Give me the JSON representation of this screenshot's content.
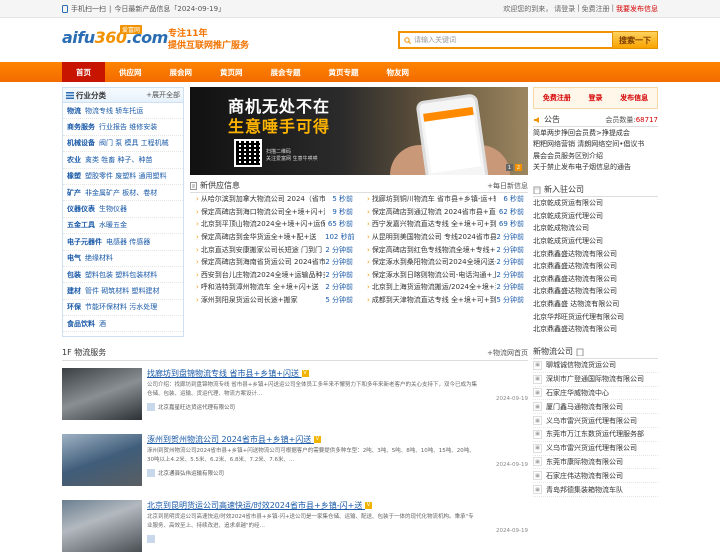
{
  "topbar": {
    "mobile": "手机扫一扫",
    "sep": "|",
    "today": "今日最新产品信息「2024-09-19」",
    "welcome": "欢迎您的到来，",
    "login": "请登录",
    "register": "免费注册",
    "publish": "我要发布信息",
    "pipe1": "|",
    "pipe2": "|"
  },
  "header": {
    "logo_a": "aifu",
    "logo_b": "360",
    "logo_c": ".com",
    "logo_badge": "爱富网",
    "slogan1": "专注11年",
    "slogan2": "提供互联网推广服务",
    "search_placeholder": "请输入关键词",
    "search_button": "搜索一下"
  },
  "nav": [
    "首页",
    "供应网",
    "展会网",
    "黄页网",
    "展会专题",
    "黄页专题",
    "物友网"
  ],
  "categories": {
    "title": "行业分类",
    "more": "+展开全部",
    "rows": [
      {
        "c": "物流",
        "s": "物流专线  轿车托运"
      },
      {
        "c": "商务服务",
        "s": "行业报告  维修安装"
      },
      {
        "c": "机械设备",
        "s": "阀门  泵  模具  工程机械"
      },
      {
        "c": "农业",
        "s": "禽类  牲畜  种子、种苗"
      },
      {
        "c": "橡塑",
        "s": "塑胶零件  废塑料  通用塑料"
      },
      {
        "c": "矿产",
        "s": "非金属矿产  板材、卷材"
      },
      {
        "c": "仪器仪表",
        "s": "生物仪器"
      },
      {
        "c": "五金工具",
        "s": "水暖五金"
      },
      {
        "c": "电子元器件",
        "s": "电感器  传感器"
      },
      {
        "c": "电气",
        "s": "绝缘材料"
      },
      {
        "c": "包装",
        "s": "塑料包装  塑料包装材料"
      },
      {
        "c": "建材",
        "s": "管件  砌筑材料  塑料建材"
      },
      {
        "c": "环保",
        "s": "节能环保材料  污水处理"
      },
      {
        "c": "食品饮料",
        "s": "酒"
      }
    ]
  },
  "banner": {
    "line1": "商机无处不在",
    "line2": "生意唾手可得",
    "qr_text1": "扫描二维码",
    "qr_text2": "关注爱富网  生意牛哄哄",
    "dot1": "1",
    "dot2": "2"
  },
  "right_top": [
    "免费注册",
    "登录",
    "发布信息"
  ],
  "notice": {
    "title": "公告",
    "count_label": "会员数量:",
    "count": "68717",
    "items": [
      "简单两步挣回会员费>挣提成会",
      "粑粑网络营销 清朗网络空间•倡议书",
      "展会会员服务区别介绍",
      "关于禁止发布电子烟信息的通告"
    ]
  },
  "info": {
    "title": "新供应信息",
    "more": "+每日新信息",
    "rows": [
      [
        "从哈尔滨到加拿大物流公司 2024（省市",
        "5 秒前",
        "找廊坊到铜川物流车 省市县+乡镇-运+输",
        "6 秒前"
      ],
      [
        "保定高碑店到海口物流公司全+境+闪+送",
        "9 秒前",
        "保定高碑店到通辽物流 2024省市县+直达",
        "62 秒前"
      ],
      [
        "北京到平顶山物流2024全+境+闪+运保时",
        "65 秒前",
        "西宁发嘉兴物流直达专线  全+境+可+到",
        "69 秒前"
      ],
      [
        "保定高碑店到金华货运全+境+配+送",
        "102 秒前",
        "从昆明到美国物流公司 专线2024省市县+",
        "2 分钟前"
      ],
      [
        "北京直达到安康搬家公司长短途 门到门",
        "2 分钟前",
        "保定高碑店到红色专线物流全境+专线+",
        "2 分钟前"
      ],
      [
        "保定高碑店到海南省货运公司 2024省市县+",
        "2 分钟前",
        "保定涿水到桑阳物流公司2024全境闪送+",
        "2 分钟前"
      ],
      [
        "西安到台儿庄物流2024全境+运输品种多",
        "2 分钟前",
        "保定涿水到日喀则物流公司-电话沟通+上",
        "2 分钟前"
      ],
      [
        "呼和浩特到漳州物流车  全+境+闪+送",
        "2 分钟前",
        "北京到上海货运物流搬运/2024全+境+到",
        "2 分钟前"
      ],
      [
        "涿州到阳泉货运公司长途+搬家",
        "5 分钟前",
        "成都到天津物流直达专线  全+境+可+到",
        "5 分钟前"
      ]
    ]
  },
  "newco": {
    "title": "新入驻公司",
    "items": [
      "北京乾成货运有限公司",
      "北京乾成货运代理公司",
      "北京乾成物流公司",
      "北京乾成货运代理公司",
      "北京鼎鑫盛达物流有限公司",
      "北京鼎鑫盛达物流有限公司",
      "北京鼎鑫盛达物流有限公司",
      "北京鼎鑫盛达物流有限公司",
      "北京鼎鑫盛  达物流有限公司",
      "北京华邦旺货运代理有限公司",
      "北京鼎鑫盛达物流有限公司"
    ]
  },
  "products": {
    "title": "1F 物流服务",
    "more": "+物流网首页",
    "items": [
      {
        "title": "找廊坊到盘锦物流专线 省市县+乡镇+闪送",
        "desc": "公司介绍：找廊坊到盘锦物流专线 省市县+乡镇+闪送运公司全体员工多年来不懈努力下和多年来新老客户的关心支持下，双今已成为集仓储、包装、运输、货运代理、物流方案设计…",
        "date": "2024-09-19",
        "company": "北京嘉星旺达货运代理有限公司"
      },
      {
        "title": "涿州到贺州物流公司 2024省市县+乡镇+闪送",
        "desc": "涿州到贺州物流公司2024省市县+乡镇+闪送物流公司可根据客户的需要提供多种车型：2吨、3吨、5吨、8吨、10吨、15吨、20吨、30吨以上4.2米、5.5米、6.2米、6.8米、7.2米、7.6米、…",
        "date": "2024-09-19",
        "company": "北京通驿弘伟运输有限公司"
      },
      {
        "title": "北京到昆明货运公司高速快运/时效2024省市县+乡镇-闪+送",
        "desc": "北京到昆明货运公司高速快运/时效2024省市县+乡镇-闪+送公司是一家集仓储、运输、配送、包装于一体的现代化物流机构。秉承\"专业服务、高效至上、持续改进、追求卓越\"的经…",
        "date": "2024-09-19",
        "company": ""
      }
    ]
  },
  "newco2": {
    "title": "新物流公司",
    "items": [
      "聊城诚信物流货运公司",
      "深圳市广登通国际物流有限公司",
      "石家庄华威物流中心",
      "厦门鑫马通物流有限公司",
      "义乌市雷兴货运代理有限公司",
      "东莞市万江东数货运代理服务部",
      "义乌市雷兴货运代理有限公司",
      "东莞市康际物流有限公司",
      "石家庄伟达物流有限公司",
      "青岛邦德集装箱物流车队"
    ]
  },
  "colors": {
    "accent": "#f27300",
    "nav_active": "#c71500",
    "link": "#1a5aa8"
  }
}
